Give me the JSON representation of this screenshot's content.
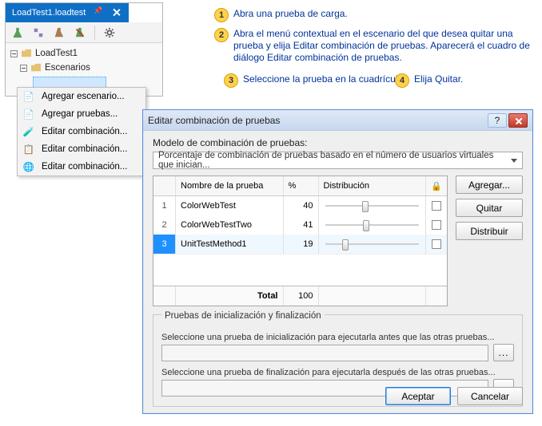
{
  "tab": {
    "title": "LoadTest1.loadtest"
  },
  "tree": {
    "root": "LoadTest1",
    "scenarios_label": "Escenarios",
    "selected_placeholder": ""
  },
  "context_menu": {
    "items": [
      "Agregar escenario...",
      "Agregar pruebas...",
      "Editar combinación...",
      "Editar combinación...",
      "Editar combinación..."
    ]
  },
  "callouts": {
    "c1": "Abra una prueba de carga.",
    "c2": "Abra el menú contextual en el escenario del que desea quitar una prueba y elija Editar combinación de pruebas. Aparecerá el cuadro de diálogo Editar combinación de pruebas.",
    "c3": "Seleccione la prueba en la cuadrícula.",
    "c4": "Elija Quitar."
  },
  "dialog": {
    "title": "Editar combinación de pruebas",
    "model_label": "Modelo de combinación de pruebas:",
    "model_value": "Porcentaje de combinación de pruebas basado en el número de usuarios virtuales que inician...",
    "columns": {
      "name": "Nombre de la prueba",
      "pct": "%",
      "dist": "Distribución",
      "lock": "🔒"
    },
    "rows": [
      {
        "idx": "1",
        "name": "ColorWebTest",
        "pct": "40",
        "thumb": 40
      },
      {
        "idx": "2",
        "name": "ColorWebTestTwo",
        "pct": "41",
        "thumb": 41
      },
      {
        "idx": "3",
        "name": "UnitTestMethod1",
        "pct": "19",
        "thumb": 19,
        "selected": true
      }
    ],
    "total_label": "Total",
    "total_value": "100",
    "buttons": {
      "add": "Agregar...",
      "remove": "Quitar",
      "distribute": "Distribuir"
    },
    "fieldset": {
      "legend": "Pruebas de inicialización y finalización",
      "init_desc": "Seleccione una prueba de inicialización para ejecutarla antes que las otras pruebas...",
      "final_desc": "Seleccione una prueba de finalización para ejecutarla después de las otras pruebas...",
      "browse": "..."
    },
    "ok": "Aceptar",
    "cancel": "Cancelar"
  }
}
